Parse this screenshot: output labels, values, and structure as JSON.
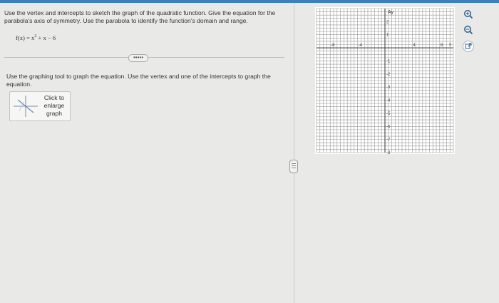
{
  "question": {
    "instruction": "Use the vertex and intercepts to sketch the graph of the quadratic function. Give the equation for the parabola's axis of symmetry. Use the parabola to identify the function's domain and range.",
    "function_lhs": "f(x) = x",
    "function_exp": "2",
    "function_rhs": " + x − 6",
    "more_label": "•••••"
  },
  "graph_tool": {
    "instruction": "Use the graphing tool to graph the equation. Use the vertex and one of the intercepts to graph the equation.",
    "enlarge_line1": "Click to",
    "enlarge_line2": "enlarge",
    "enlarge_line3": "graph"
  },
  "graph": {
    "y_axis_label": "Ay",
    "x_axis_label": "x",
    "x_range": [
      -10,
      10
    ],
    "y_range": [
      -8,
      3
    ],
    "x_tick_labels": [
      "-8",
      "-4",
      "",
      "4",
      "8"
    ],
    "y_tick_labels": [
      "2",
      "1",
      "-1",
      "-2",
      "-3",
      "-4",
      "-5",
      "-6",
      "-7",
      "-8"
    ],
    "grid": true
  },
  "tools": {
    "zoom_in": "zoom-in-icon",
    "zoom_out": "zoom-out-icon",
    "pop_out": "external-link-icon"
  }
}
